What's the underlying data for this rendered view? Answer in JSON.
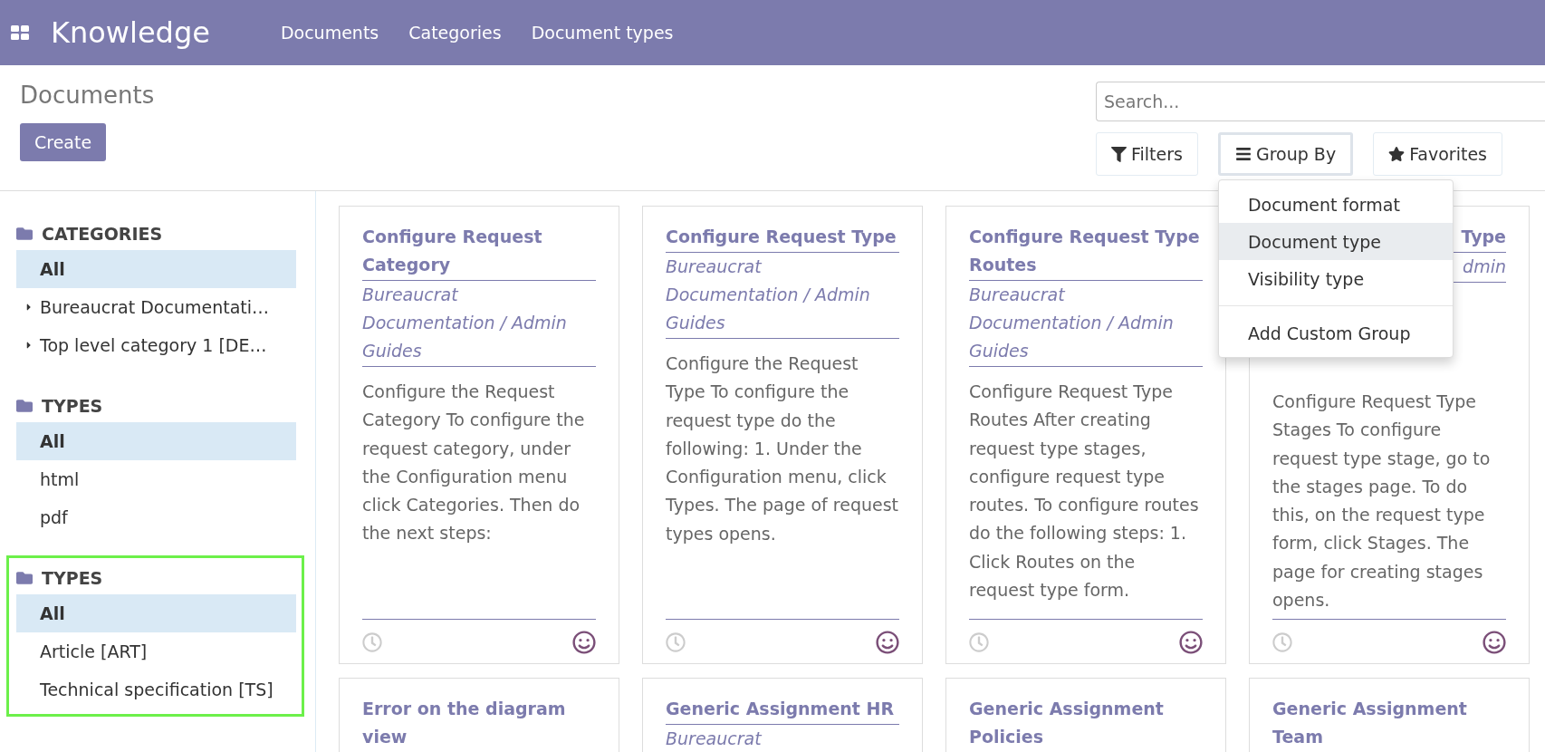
{
  "app": {
    "title": "Knowledge",
    "menu": [
      {
        "label": "Documents"
      },
      {
        "label": "Categories"
      },
      {
        "label": "Document types"
      }
    ]
  },
  "page": {
    "title": "Documents",
    "create_button": "Create"
  },
  "search": {
    "placeholder": "Search..."
  },
  "search_buttons": [
    {
      "label": "Filters",
      "kind": "filter",
      "selected": false
    },
    {
      "label": "Group By",
      "kind": "group",
      "selected": true
    },
    {
      "label": "Favorites",
      "kind": "favorite",
      "selected": false
    }
  ],
  "group_by_menu": {
    "items": [
      {
        "label": "Document format",
        "selected": false
      },
      {
        "label": "Document type",
        "selected": true
      },
      {
        "label": "Visibility type",
        "selected": false
      }
    ],
    "custom": "Add Custom Group"
  },
  "sidebar": {
    "sections": [
      {
        "title": "CATEGORIES",
        "highlighted": false,
        "items": [
          {
            "label": "All",
            "selected": true,
            "expandable": false
          },
          {
            "label": "Bureaucrat Documentati…",
            "selected": false,
            "expandable": true
          },
          {
            "label": "Top level category 1 [DE…",
            "selected": false,
            "expandable": true
          }
        ]
      },
      {
        "title": "TYPES",
        "highlighted": false,
        "items": [
          {
            "label": "All",
            "selected": true,
            "expandable": false
          },
          {
            "label": "html",
            "selected": false,
            "expandable": false
          },
          {
            "label": "pdf",
            "selected": false,
            "expandable": false
          }
        ]
      },
      {
        "title": "TYPES",
        "highlighted": true,
        "items": [
          {
            "label": "All",
            "selected": true,
            "expandable": false
          },
          {
            "label": "Article [ART]",
            "selected": false,
            "expandable": false
          },
          {
            "label": "Technical specification [TS]",
            "selected": false,
            "expandable": false
          }
        ]
      }
    ]
  },
  "cards": [
    {
      "title": "Configure Request Category",
      "category": "Bureaucrat Documentation / Admin Guides",
      "description": "Configure the Request Category To configure the request category, under the Configuration menu click Categories. Then do the next steps:",
      "covered": false
    },
    {
      "title": "Configure Request Type",
      "category": "Bureaucrat Documentation / Admin Guides",
      "description": "Configure the Request Type To configure the request type do the following: 1. Under the Configuration menu, click Types. The page of request types opens.",
      "covered": false
    },
    {
      "title": "Configure Request Type Routes",
      "category": "Bureaucrat Documentation / Admin Guides",
      "description": "Configure Request Type Routes After creating request type stages, configure request type routes. To configure routes do the following steps: 1. Click Routes on the request type form.",
      "covered": false
    },
    {
      "title": "Type",
      "category": "dmin",
      "description": "Configure Request Type Stages To configure request type stage, go to the stages page. To do this, on the request type form, click Stages. The page for creating stages opens.",
      "covered": true
    },
    {
      "title": "Error on the diagram view",
      "covered": false
    },
    {
      "title": "Generic Assignment HR",
      "category": "Bureaucrat",
      "covered": false
    },
    {
      "title": "Generic Assignment Policies",
      "covered": false
    },
    {
      "title": "Generic Assignment Team",
      "covered": false
    }
  ]
}
